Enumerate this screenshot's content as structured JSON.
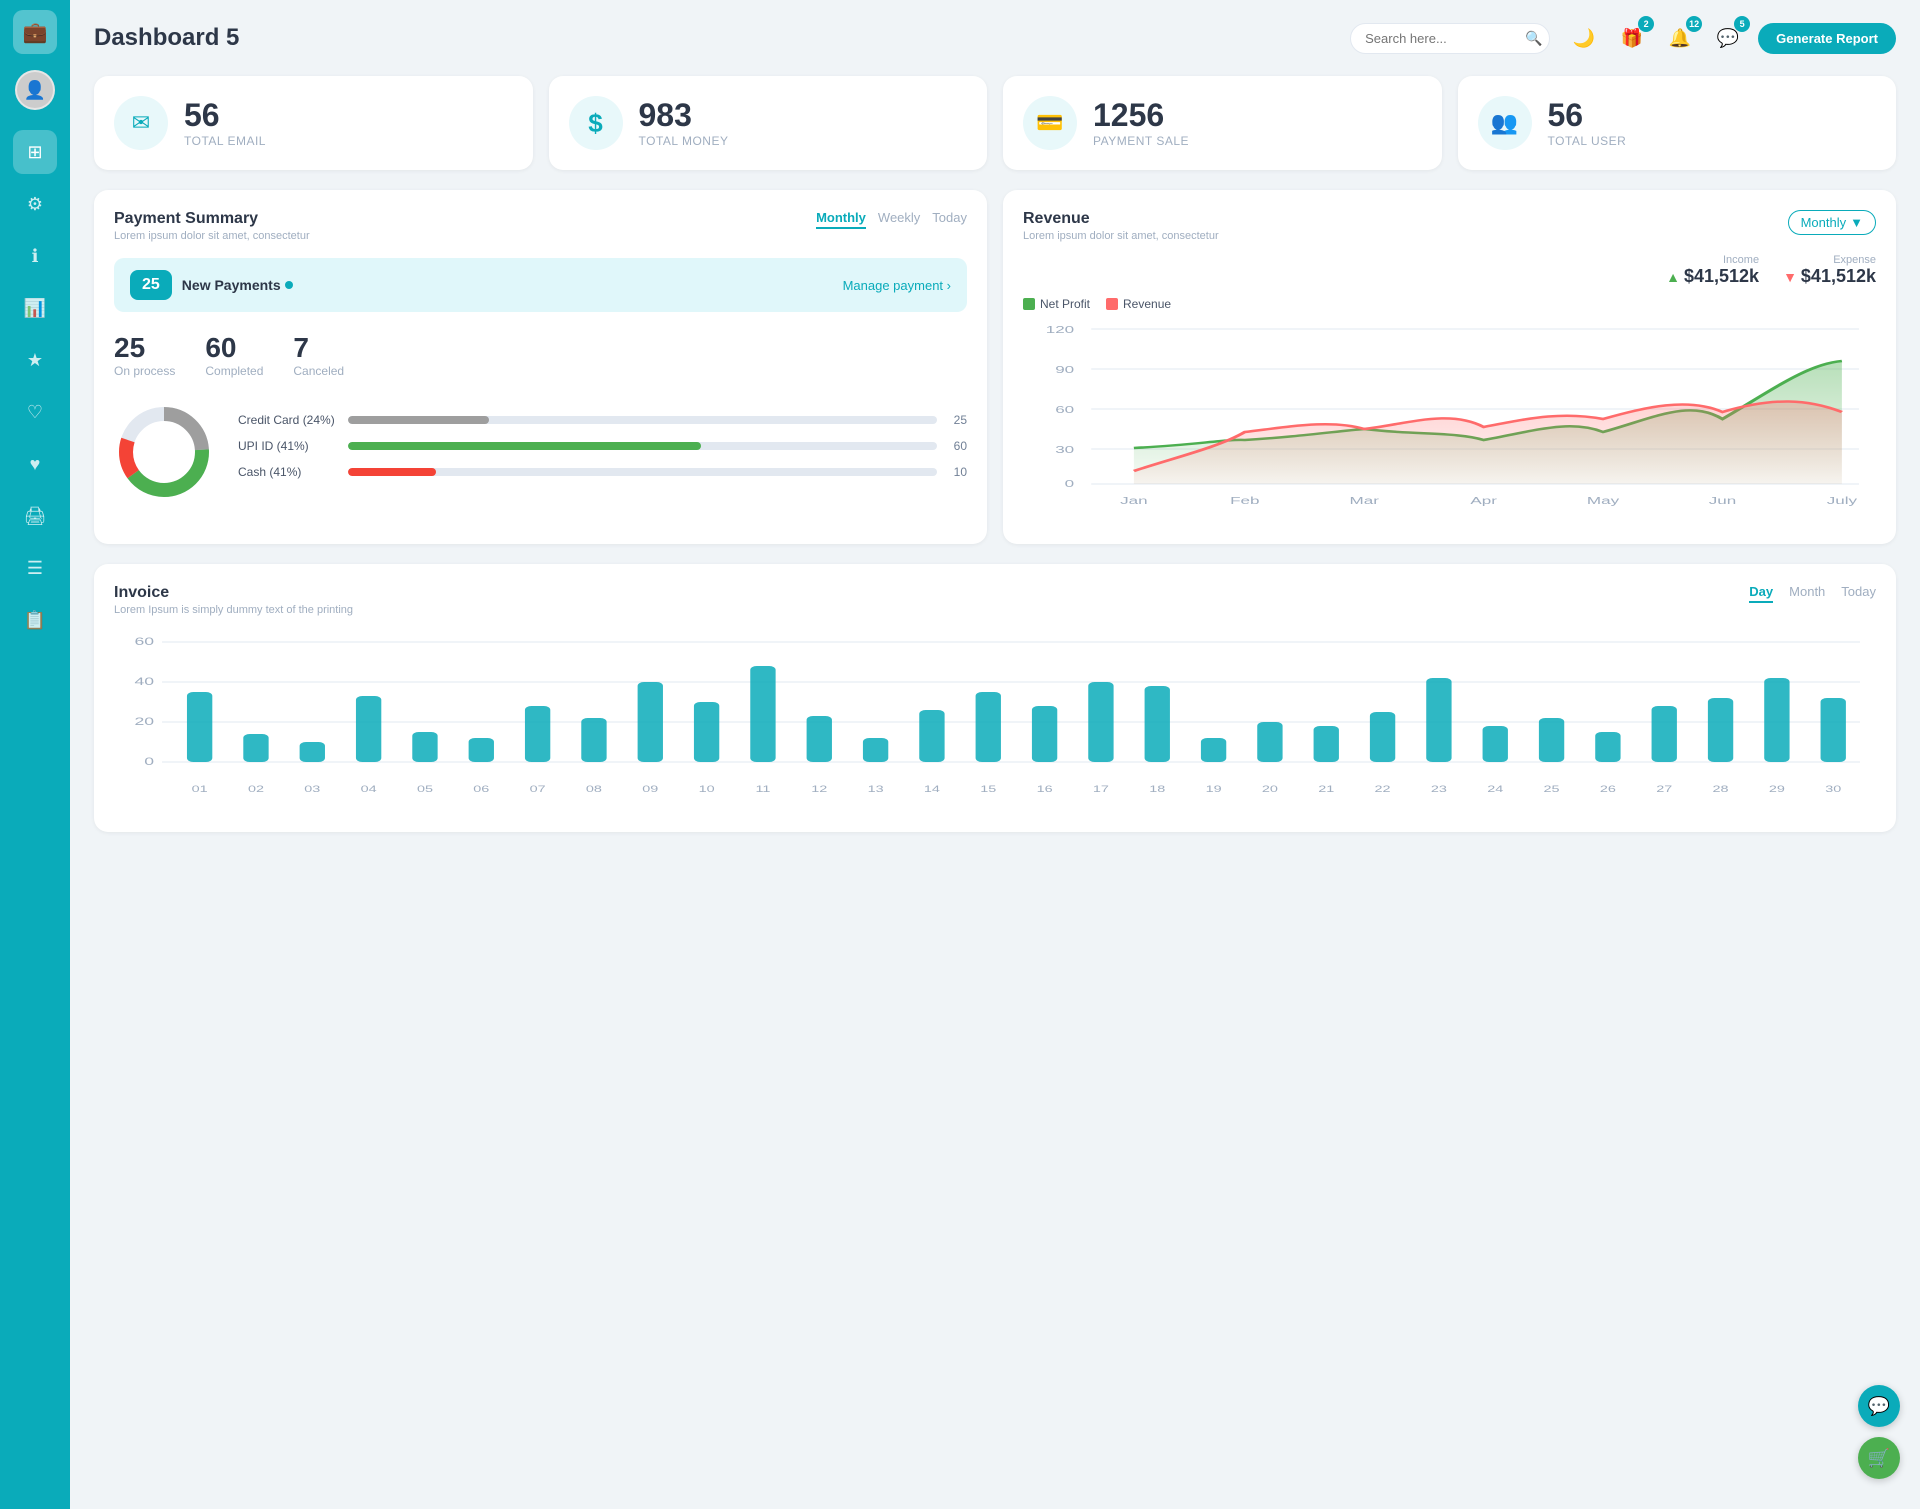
{
  "sidebar": {
    "logo_icon": "💼",
    "items": [
      {
        "id": "dashboard",
        "icon": "⊞",
        "active": true
      },
      {
        "id": "settings",
        "icon": "⚙"
      },
      {
        "id": "info",
        "icon": "ℹ"
      },
      {
        "id": "chart",
        "icon": "📊"
      },
      {
        "id": "star",
        "icon": "★"
      },
      {
        "id": "heart-outline",
        "icon": "♡"
      },
      {
        "id": "heart",
        "icon": "♥"
      },
      {
        "id": "print",
        "icon": "🖨"
      },
      {
        "id": "menu",
        "icon": "☰"
      },
      {
        "id": "list",
        "icon": "📋"
      }
    ]
  },
  "header": {
    "title": "Dashboard 5",
    "search_placeholder": "Search here...",
    "generate_button": "Generate Report",
    "badge_gift": "2",
    "badge_bell": "12",
    "badge_chat": "5"
  },
  "stats": [
    {
      "id": "total-email",
      "icon": "✉",
      "value": "56",
      "label": "TOTAL EMAIL"
    },
    {
      "id": "total-money",
      "icon": "$",
      "value": "983",
      "label": "TOTAL MONEY"
    },
    {
      "id": "payment-sale",
      "icon": "💳",
      "value": "1256",
      "label": "PAYMENT SALE"
    },
    {
      "id": "total-user",
      "icon": "👥",
      "value": "56",
      "label": "TOTAL USER"
    }
  ],
  "payment_summary": {
    "title": "Payment Summary",
    "subtitle": "Lorem ipsum dolor sit amet, consectetur",
    "tabs": [
      "Monthly",
      "Weekly",
      "Today"
    ],
    "active_tab": "Monthly",
    "new_payments": {
      "count": "25",
      "label": "New Payments",
      "manage_link": "Manage payment ›"
    },
    "stats": [
      {
        "value": "25",
        "label": "On process"
      },
      {
        "value": "60",
        "label": "Completed"
      },
      {
        "value": "7",
        "label": "Canceled"
      }
    ],
    "payment_methods": [
      {
        "name": "Credit Card (24%)",
        "color": "#9e9e9e",
        "percent": 24,
        "value": 25
      },
      {
        "name": "UPI ID (41%)",
        "color": "#4caf50",
        "percent": 60,
        "value": 60
      },
      {
        "name": "Cash (41%)",
        "color": "#f44336",
        "percent": 15,
        "value": 10
      }
    ]
  },
  "revenue": {
    "title": "Revenue",
    "subtitle": "Lorem ipsum dolor sit amet, consectetur",
    "dropdown": "Monthly",
    "income_label": "Income",
    "income_value": "$41,512k",
    "expense_label": "Expense",
    "expense_value": "$41,512k",
    "legend": [
      {
        "label": "Net Profit",
        "color": "#4caf50"
      },
      {
        "label": "Revenue",
        "color": "#ff6b6b"
      }
    ],
    "x_labels": [
      "Jan",
      "Feb",
      "Mar",
      "Apr",
      "May",
      "Jun",
      "July"
    ],
    "y_labels": [
      "0",
      "30",
      "60",
      "90",
      "120"
    ],
    "net_profit_data": [
      28,
      30,
      35,
      30,
      40,
      50,
      95
    ],
    "revenue_data": [
      10,
      25,
      40,
      35,
      45,
      55,
      55
    ]
  },
  "invoice": {
    "title": "Invoice",
    "subtitle": "Lorem Ipsum is simply dummy text of the printing",
    "tabs": [
      "Day",
      "Month",
      "Today"
    ],
    "active_tab": "Day",
    "y_labels": [
      "0",
      "20",
      "40",
      "60"
    ],
    "x_labels": [
      "01",
      "02",
      "03",
      "04",
      "05",
      "06",
      "07",
      "08",
      "09",
      "10",
      "11",
      "12",
      "13",
      "14",
      "15",
      "16",
      "17",
      "18",
      "19",
      "20",
      "21",
      "22",
      "23",
      "24",
      "25",
      "26",
      "27",
      "28",
      "29",
      "30"
    ],
    "bar_data": [
      35,
      14,
      10,
      33,
      15,
      12,
      28,
      22,
      40,
      30,
      48,
      23,
      12,
      26,
      35,
      28,
      40,
      38,
      12,
      20,
      18,
      25,
      42,
      18,
      22,
      15,
      28,
      32,
      42,
      32
    ]
  },
  "colors": {
    "primary": "#0aabba",
    "accent_green": "#4caf50",
    "accent_red": "#f44336",
    "accent_orange": "#ff9800"
  }
}
